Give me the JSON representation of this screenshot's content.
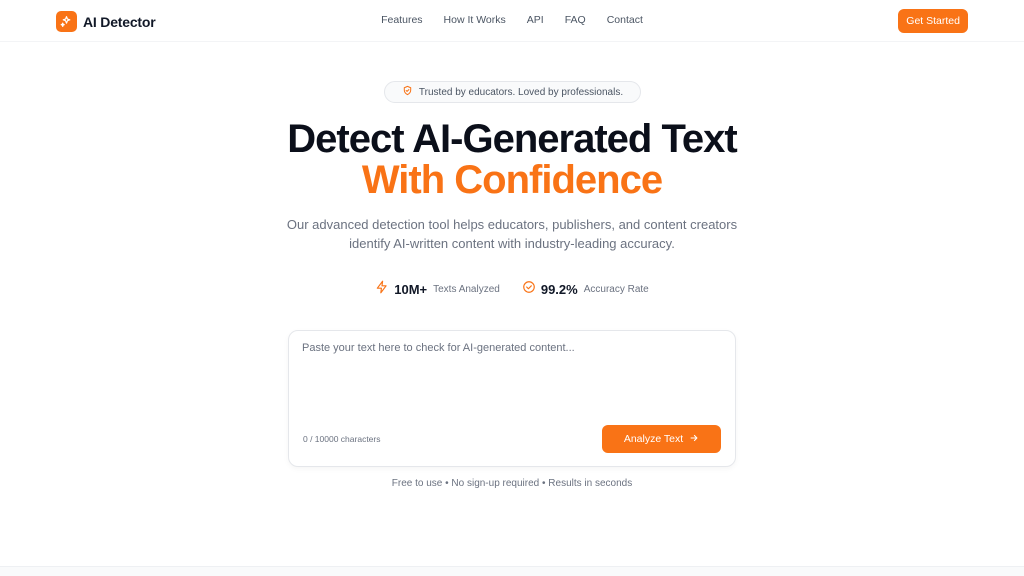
{
  "nav": {
    "brand": "AI Detector",
    "links": [
      "Features",
      "How It Works",
      "API",
      "FAQ",
      "Contact"
    ],
    "cta": "Get Started"
  },
  "badge": {
    "text": "Trusted by educators. Loved by professionals.",
    "icon": "shield-check-icon"
  },
  "hero": {
    "title_line1": "Detect AI-Generated Text",
    "title_line2": "With Confidence",
    "subtitle_line1": "Our advanced detection tool helps educators, publishers, and content creators",
    "subtitle_line2": "identify AI-written content with industry-leading accuracy."
  },
  "stats": [
    {
      "value": "10M+",
      "label": "Texts Analyzed",
      "icon": "lightning-icon"
    },
    {
      "value": "99.2%",
      "label": "Accuracy Rate",
      "icon": "check-circle-icon"
    }
  ],
  "analyzer": {
    "placeholder": "Paste your text here to check for AI-generated content...",
    "value": "",
    "char_count": "0 / 10000 characters",
    "button": "Analyze Text"
  },
  "footnote": "Free to use • No sign-up required • Results in seconds",
  "colors": {
    "accent": "#f97316",
    "text": "#0b0f1a",
    "muted": "#6b7280"
  }
}
